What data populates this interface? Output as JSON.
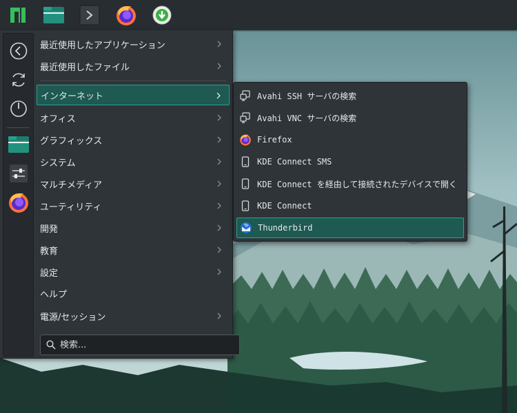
{
  "colors": {
    "panel_bg": "#282d32",
    "menu_bg": "#2f3438",
    "highlight_bg": "#1e5952",
    "highlight_border": "#2aa393",
    "text": "#e6e8ea"
  },
  "panel": {
    "buttons": [
      {
        "icon": "manjaro-logo-icon"
      },
      {
        "icon": "folder-icon"
      },
      {
        "icon": "terminal-icon"
      },
      {
        "icon": "firefox-icon"
      },
      {
        "icon": "software-update-icon"
      }
    ]
  },
  "favorites": [
    {
      "icon": "back-arrow-icon"
    },
    {
      "icon": "refresh-icon"
    },
    {
      "icon": "power-icon"
    },
    {
      "icon": "folder-icon"
    },
    {
      "icon": "settings-sliders-icon"
    },
    {
      "icon": "firefox-icon"
    }
  ],
  "menu": {
    "recent": [
      {
        "label": "最近使用したアプリケーション"
      },
      {
        "label": "最近使用したファイル"
      }
    ],
    "categories": [
      {
        "label": "インターネット"
      },
      {
        "label": "オフィス"
      },
      {
        "label": "グラフィックス"
      },
      {
        "label": "システム"
      },
      {
        "label": "マルチメディア"
      },
      {
        "label": "ユーティリティ"
      },
      {
        "label": "開発"
      },
      {
        "label": "教育"
      },
      {
        "label": "設定"
      },
      {
        "label": "ヘルプ"
      },
      {
        "label": "電源/セッション"
      }
    ],
    "selected_category": "インターネット",
    "search": {
      "placeholder": "検索..."
    }
  },
  "submenu": {
    "items": [
      {
        "label": "Avahi SSH サーバの検索",
        "icon": "network-icon"
      },
      {
        "label": "Avahi VNC サーバの検索",
        "icon": "network-icon"
      },
      {
        "label": "Firefox",
        "icon": "firefox-icon"
      },
      {
        "label": "KDE Connect SMS",
        "icon": "phone-icon"
      },
      {
        "label": "KDE Connect を経由して接続されたデバイスで開く",
        "icon": "phone-icon"
      },
      {
        "label": "KDE Connect",
        "icon": "phone-icon"
      },
      {
        "label": "Thunderbird",
        "icon": "thunderbird-icon"
      }
    ],
    "selected_item": "Thunderbird"
  }
}
